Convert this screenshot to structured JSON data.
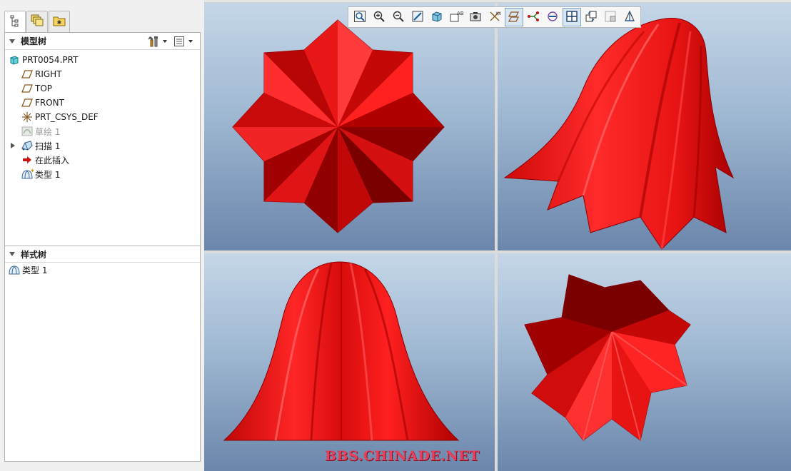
{
  "model_tree": {
    "title": "模型树",
    "items": [
      {
        "label": "PRT0054.PRT",
        "icon": "part-icon",
        "level": 0
      },
      {
        "label": "RIGHT",
        "icon": "datum-plane-icon",
        "level": 1
      },
      {
        "label": "TOP",
        "icon": "datum-plane-icon",
        "level": 1
      },
      {
        "label": "FRONT",
        "icon": "datum-plane-icon",
        "level": 1
      },
      {
        "label": "PRT_CSYS_DEF",
        "icon": "coordinate-system-icon",
        "level": 1
      },
      {
        "label": "草绘 1",
        "icon": "sketch-icon",
        "level": 1,
        "suppressed": true
      },
      {
        "label": "扫描 1",
        "icon": "sweep-icon",
        "level": 1,
        "expandable": true
      },
      {
        "label": "在此插入",
        "icon": "insert-here-arrow-icon",
        "level": 1
      },
      {
        "label": "类型 1",
        "icon": "style-type-icon",
        "level": 1
      }
    ]
  },
  "style_tree": {
    "title": "样式树",
    "items": [
      {
        "label": "类型 1",
        "icon": "style-type-icon"
      }
    ]
  },
  "tabs": [
    {
      "icon": "model-tree-tab-icon",
      "active": true
    },
    {
      "icon": "layers-tab-icon",
      "active": false
    },
    {
      "icon": "folder-browser-tab-icon",
      "active": false
    }
  ],
  "toolbar": [
    {
      "icon": "refit-icon",
      "active": false
    },
    {
      "icon": "zoom-in-icon",
      "active": false
    },
    {
      "icon": "zoom-out-icon",
      "active": false
    },
    {
      "icon": "repaint-icon",
      "active": false
    },
    {
      "icon": "display-style-icon",
      "active": false
    },
    {
      "icon": "saved-views-icon",
      "active": false
    },
    {
      "icon": "view-manager-icon",
      "active": false
    },
    {
      "icon": "datum-display-icon",
      "active": false
    },
    {
      "icon": "plane-display-icon",
      "active": true
    },
    {
      "icon": "axis-display-icon",
      "active": false
    },
    {
      "icon": "point-display-icon",
      "active": false
    },
    {
      "icon": "four-viewports-icon",
      "active": true
    },
    {
      "icon": "view-sync-icon",
      "active": false
    },
    {
      "icon": "active-view-icon",
      "active": false
    },
    {
      "icon": "perspective-icon",
      "active": false
    }
  ],
  "colors": {
    "model_red": "#e81414",
    "model_dark": "#7a0000",
    "viewport_top": "#c5d6e8",
    "viewport_bottom": "#6a86ab"
  },
  "watermark": "BBS.CHINADE.NET"
}
